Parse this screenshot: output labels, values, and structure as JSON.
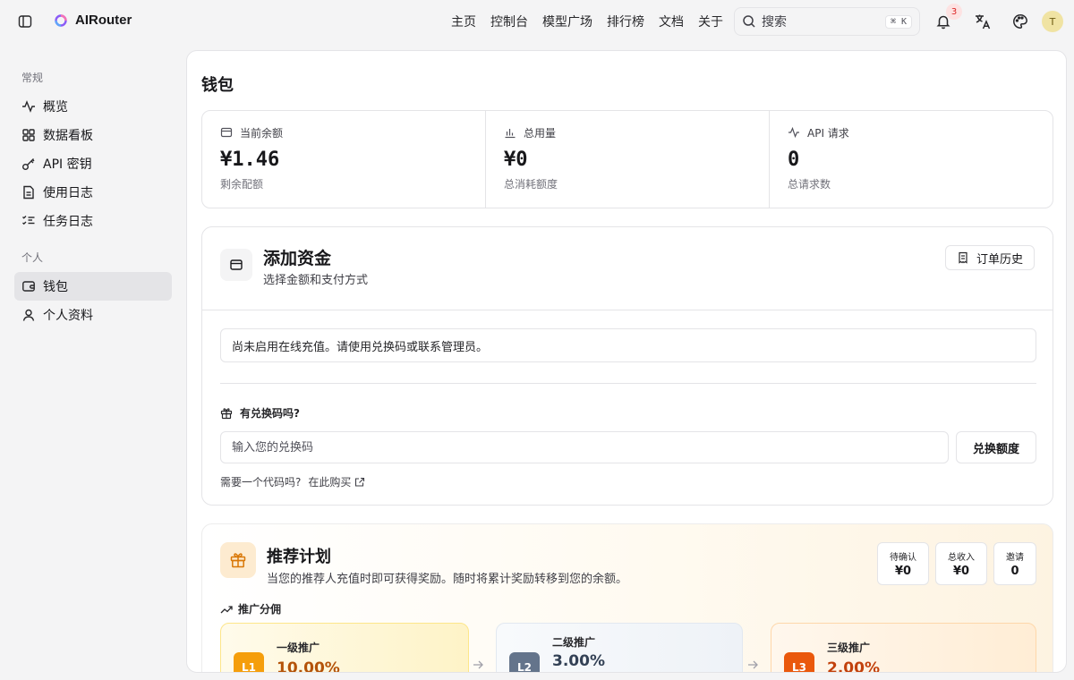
{
  "app": {
    "name": "AIRouter"
  },
  "nav": [
    "主页",
    "控制台",
    "模型广场",
    "排行榜",
    "文档",
    "关于"
  ],
  "search": {
    "placeholder": "搜索",
    "shortcut": "⌘ K"
  },
  "notifications": {
    "count": "3"
  },
  "user": {
    "initial": "T"
  },
  "sidebar": {
    "group1_label": "常规",
    "group1": [
      {
        "label": "概览",
        "icon": "activity-icon"
      },
      {
        "label": "数据看板",
        "icon": "dashboard-icon"
      },
      {
        "label": "API 密钥",
        "icon": "key-icon"
      },
      {
        "label": "使用日志",
        "icon": "file-text-icon"
      },
      {
        "label": "任务日志",
        "icon": "list-checks-icon"
      }
    ],
    "group2_label": "个人",
    "group2": [
      {
        "label": "钱包",
        "icon": "wallet-icon",
        "active": true
      },
      {
        "label": "个人资料",
        "icon": "user-icon"
      }
    ]
  },
  "page": {
    "title": "钱包"
  },
  "stats": [
    {
      "label": "当前余额",
      "value": "¥1.46",
      "sub": "剩余配额"
    },
    {
      "label": "总用量",
      "value": "¥0",
      "sub": "总消耗额度"
    },
    {
      "label": "API 请求",
      "value": "0",
      "sub": "总请求数"
    }
  ],
  "fund": {
    "title": "添加资金",
    "subtitle": "选择金额和支付方式",
    "order_history": "订单历史",
    "notice": "尚未启用在线充值。请使用兑换码或联系管理员。",
    "redeem_label": "有兑换码吗?",
    "redeem_placeholder": "输入您的兑换码",
    "redeem_button": "兑换额度",
    "need_code": "需要一个代码吗?",
    "buy_here": "在此购买"
  },
  "referral": {
    "title": "推荐计划",
    "subtitle": "当您的推荐人充值时即可获得奖励。随时将累计奖励转移到您的余额。",
    "stats": [
      {
        "label": "待确认",
        "value": "¥0"
      },
      {
        "label": "总收入",
        "value": "¥0"
      },
      {
        "label": "邀请",
        "value": "0"
      }
    ],
    "section": "推广分佣",
    "tiers": [
      {
        "badge": "L1",
        "name": "一级推广",
        "percent": "10.00%"
      },
      {
        "badge": "L2",
        "name": "二级推广",
        "percent": "3.00%"
      },
      {
        "badge": "L3",
        "name": "三级推广",
        "percent": "2.00%"
      }
    ]
  },
  "colors": {
    "tier1": "#f59e0b",
    "tier2": "#64748b",
    "tier3": "#ea580c",
    "percent1": "#b45309",
    "percent2": "#334155",
    "percent3": "#c2410c"
  }
}
